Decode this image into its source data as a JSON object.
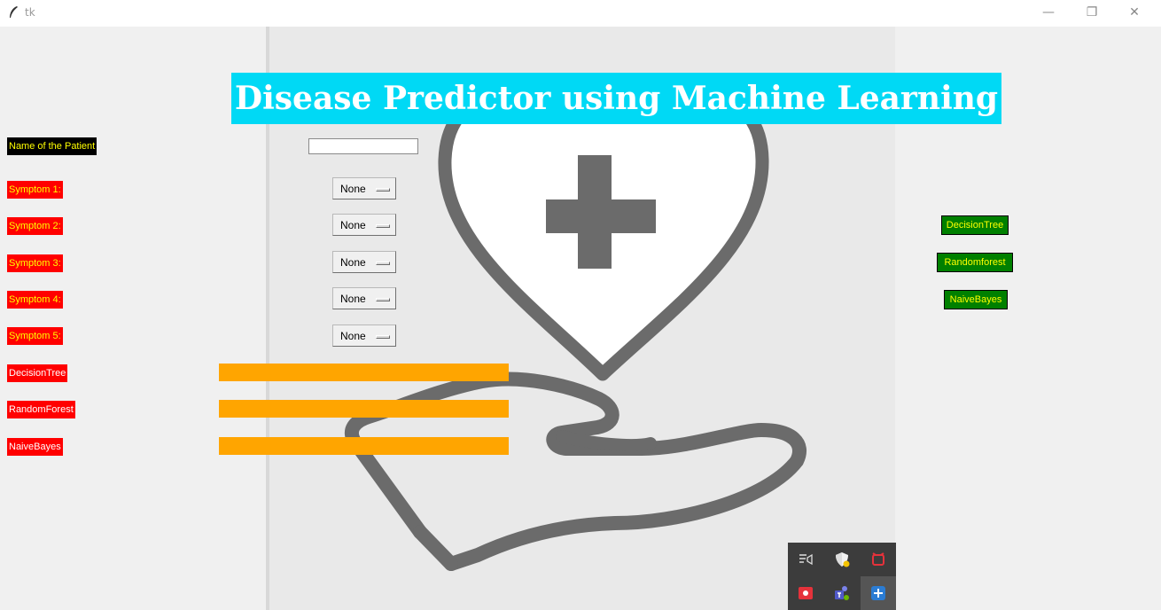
{
  "window": {
    "title": "tk",
    "controls": {
      "minimize": "—",
      "restore": "❐",
      "close": "✕"
    }
  },
  "heading": "Disease Predictor using Machine Learning",
  "labels": {
    "patient_name": "Name of the Patient",
    "symptoms": [
      "Symptom 1:",
      "Symptom 2:",
      "Symptom 3:",
      "Symptom 4:",
      "Symptom 5:"
    ],
    "results": [
      "DecisionTree",
      "RandomForest",
      "NaiveBayes"
    ]
  },
  "inputs": {
    "patient_name_value": ""
  },
  "symptom_selects": [
    "None",
    "None",
    "None",
    "None",
    "None"
  ],
  "buttons": {
    "decision_tree": "DecisionTree",
    "random_forest": "Randomforest",
    "naive_bayes": "NaiveBayes"
  },
  "result_values": [
    "",
    "",
    ""
  ],
  "tray_icons": [
    "notification-center-icon",
    "security-shield-icon",
    "alarm-clock-icon",
    "video-app-icon",
    "teams-icon",
    "add-icon"
  ],
  "colors": {
    "heading_bg": "#00d9f5",
    "label_red": "#ff0000",
    "label_yellow_text": "#ffff00",
    "result_bar": "#ffa500",
    "button_green": "#008000"
  }
}
